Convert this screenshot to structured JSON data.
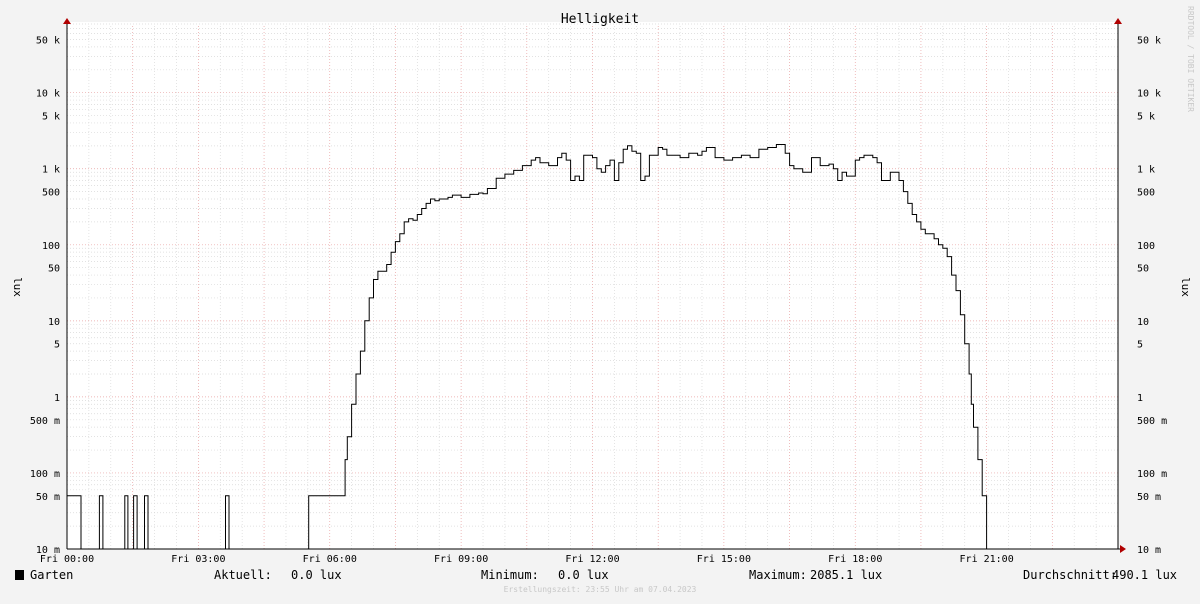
{
  "chart_data": {
    "type": "line",
    "title": "Helligkeit",
    "ylabel": "lux",
    "yscale": "log",
    "ylim": [
      0.01,
      80000
    ],
    "xlim": [
      "Fri 00:00",
      "Fri 24:00"
    ],
    "x_hours_range": [
      0,
      24
    ],
    "grid": true,
    "y_ticks": [
      {
        "value": 50000,
        "label": "50 k"
      },
      {
        "value": 10000,
        "label": "10 k"
      },
      {
        "value": 5000,
        "label": "5 k"
      },
      {
        "value": 1000,
        "label": "1 k"
      },
      {
        "value": 500,
        "label": "500"
      },
      {
        "value": 100,
        "label": "100"
      },
      {
        "value": 50,
        "label": "50"
      },
      {
        "value": 10,
        "label": "10"
      },
      {
        "value": 5,
        "label": "5"
      },
      {
        "value": 1,
        "label": "1"
      },
      {
        "value": 0.5,
        "label": "500 m"
      },
      {
        "value": 0.1,
        "label": "100 m"
      },
      {
        "value": 0.05,
        "label": "50 m"
      },
      {
        "value": 0.01,
        "label": "10 m"
      }
    ],
    "x_ticks": [
      {
        "hour": 0,
        "label": "Fri 00:00"
      },
      {
        "hour": 3,
        "label": "Fri 03:00"
      },
      {
        "hour": 6,
        "label": "Fri 06:00"
      },
      {
        "hour": 9,
        "label": "Fri 09:00"
      },
      {
        "hour": 12,
        "label": "Fri 12:00"
      },
      {
        "hour": 15,
        "label": "Fri 15:00"
      },
      {
        "hour": 18,
        "label": "Fri 18:00"
      },
      {
        "hour": 21,
        "label": "Fri 21:00"
      }
    ],
    "series": [
      {
        "name": "Garten",
        "color": "#000000",
        "points": [
          [
            0.0,
            0.05
          ],
          [
            0.3,
            0.05
          ],
          [
            0.32,
            0.01
          ],
          [
            0.72,
            0.01
          ],
          [
            0.74,
            0.05
          ],
          [
            0.8,
            0.05
          ],
          [
            0.82,
            0.01
          ],
          [
            1.3,
            0.01
          ],
          [
            1.32,
            0.05
          ],
          [
            1.37,
            0.05
          ],
          [
            1.39,
            0.01
          ],
          [
            1.5,
            0.01
          ],
          [
            1.52,
            0.05
          ],
          [
            1.58,
            0.05
          ],
          [
            1.6,
            0.01
          ],
          [
            1.75,
            0.01
          ],
          [
            1.77,
            0.05
          ],
          [
            1.83,
            0.05
          ],
          [
            1.85,
            0.01
          ],
          [
            3.6,
            0.01
          ],
          [
            3.62,
            0.05
          ],
          [
            3.68,
            0.05
          ],
          [
            3.7,
            0.01
          ],
          [
            5.5,
            0.01
          ],
          [
            5.52,
            0.05
          ],
          [
            6.3,
            0.05
          ],
          [
            6.35,
            0.15
          ],
          [
            6.4,
            0.3
          ],
          [
            6.5,
            0.8
          ],
          [
            6.6,
            2
          ],
          [
            6.7,
            4
          ],
          [
            6.8,
            10
          ],
          [
            6.9,
            20
          ],
          [
            7.0,
            35
          ],
          [
            7.1,
            45
          ],
          [
            7.2,
            45
          ],
          [
            7.3,
            55
          ],
          [
            7.4,
            80
          ],
          [
            7.5,
            110
          ],
          [
            7.6,
            140
          ],
          [
            7.7,
            200
          ],
          [
            7.8,
            220
          ],
          [
            7.9,
            210
          ],
          [
            8.0,
            250
          ],
          [
            8.1,
            300
          ],
          [
            8.2,
            350
          ],
          [
            8.3,
            400
          ],
          [
            8.4,
            380
          ],
          [
            8.5,
            400
          ],
          [
            8.7,
            420
          ],
          [
            8.8,
            450
          ],
          [
            9.0,
            420
          ],
          [
            9.2,
            460
          ],
          [
            9.4,
            480
          ],
          [
            9.5,
            470
          ],
          [
            9.6,
            550
          ],
          [
            9.8,
            750
          ],
          [
            10.0,
            850
          ],
          [
            10.2,
            950
          ],
          [
            10.4,
            1100
          ],
          [
            10.6,
            1300
          ],
          [
            10.7,
            1400
          ],
          [
            10.8,
            1200
          ],
          [
            11.0,
            1100
          ],
          [
            11.2,
            1400
          ],
          [
            11.3,
            1600
          ],
          [
            11.4,
            1300
          ],
          [
            11.5,
            700
          ],
          [
            11.6,
            800
          ],
          [
            11.7,
            700
          ],
          [
            11.8,
            1500
          ],
          [
            12.0,
            1400
          ],
          [
            12.1,
            1000
          ],
          [
            12.2,
            900
          ],
          [
            12.3,
            1100
          ],
          [
            12.4,
            1300
          ],
          [
            12.5,
            700
          ],
          [
            12.6,
            1200
          ],
          [
            12.7,
            1800
          ],
          [
            12.8,
            2000
          ],
          [
            12.9,
            1700
          ],
          [
            13.0,
            1600
          ],
          [
            13.1,
            700
          ],
          [
            13.2,
            800
          ],
          [
            13.3,
            1500
          ],
          [
            13.5,
            1900
          ],
          [
            13.6,
            1800
          ],
          [
            13.7,
            1500
          ],
          [
            14.0,
            1400
          ],
          [
            14.2,
            1600
          ],
          [
            14.4,
            1500
          ],
          [
            14.5,
            1700
          ],
          [
            14.6,
            1900
          ],
          [
            14.8,
            1400
          ],
          [
            15.0,
            1300
          ],
          [
            15.2,
            1400
          ],
          [
            15.4,
            1500
          ],
          [
            15.6,
            1400
          ],
          [
            15.8,
            1800
          ],
          [
            16.0,
            1900
          ],
          [
            16.2,
            2085.1
          ],
          [
            16.4,
            1600
          ],
          [
            16.5,
            1100
          ],
          [
            16.6,
            1000
          ],
          [
            16.8,
            900
          ],
          [
            17.0,
            1400
          ],
          [
            17.2,
            1100
          ],
          [
            17.4,
            1150
          ],
          [
            17.5,
            1000
          ],
          [
            17.6,
            700
          ],
          [
            17.7,
            900
          ],
          [
            17.8,
            800
          ],
          [
            18.0,
            1300
          ],
          [
            18.1,
            1400
          ],
          [
            18.2,
            1500
          ],
          [
            18.4,
            1400
          ],
          [
            18.5,
            1200
          ],
          [
            18.6,
            700
          ],
          [
            18.8,
            900
          ],
          [
            19.0,
            700
          ],
          [
            19.1,
            500
          ],
          [
            19.2,
            350
          ],
          [
            19.3,
            250
          ],
          [
            19.4,
            200
          ],
          [
            19.5,
            160
          ],
          [
            19.6,
            140
          ],
          [
            19.8,
            120
          ],
          [
            19.9,
            100
          ],
          [
            20.0,
            90
          ],
          [
            20.1,
            70
          ],
          [
            20.2,
            40
          ],
          [
            20.3,
            25
          ],
          [
            20.4,
            12
          ],
          [
            20.5,
            5
          ],
          [
            20.6,
            2
          ],
          [
            20.65,
            0.8
          ],
          [
            20.7,
            0.4
          ],
          [
            20.8,
            0.15
          ],
          [
            20.9,
            0.05
          ],
          [
            20.95,
            0.05
          ],
          [
            21.0,
            0.01
          ],
          [
            24.0,
            0.01
          ]
        ]
      }
    ]
  },
  "legend": {
    "series_name": "Garten",
    "swatch_color": "#000000",
    "current_label": "Aktuell:",
    "current_value": "0.0 lux",
    "min_label": "Minimum:",
    "min_value": "0.0 lux",
    "max_label": "Maximum:",
    "max_value": "2085.1 lux",
    "avg_label": "Durchschnitt:",
    "avg_value": "490.1 lux"
  },
  "footer_text": "Erstellungszeit: 23:55 Uhr am 07.04.2023",
  "watermark_text": "RRDTOOL / TOBI OETIKER",
  "colors": {
    "background": "#f3f3f3",
    "plot_background": "#ffffff",
    "major_grid": "#e8a0a0",
    "minor_grid": "#d8d8d8",
    "axis_arrow": "#b00000",
    "line": "#000000"
  }
}
